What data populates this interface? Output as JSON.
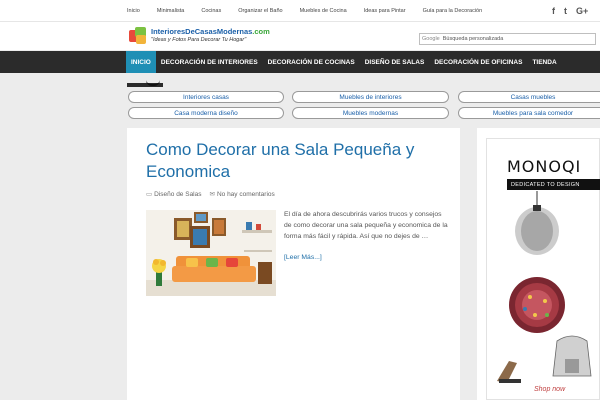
{
  "topbar": {
    "links": [
      "Inicio",
      "Minimalista",
      "Cocinas",
      "Organizar el Baño",
      "Muebles de Cocina",
      "Ideas para Pintar",
      "Guía para la Decoración"
    ],
    "social_icons": [
      "facebook-icon",
      "twitter-icon",
      "google-plus-icon"
    ],
    "social_glyphs": [
      "f",
      "𝕥",
      "G+"
    ]
  },
  "header": {
    "site_name": "InterioresDeCasasModernas",
    "site_tld": ".com",
    "tagline": "\"Ideas y Fotos Para Decorar Tu Hogar\"",
    "search_placeholder": "Búsqueda personalizada",
    "search_prefix": "Google"
  },
  "mainnav": {
    "items": [
      "INICIO",
      "DECORACIÓN DE INTERIORES",
      "DECORACIÓN DE COCINAS",
      "DISEÑO DE SALAS",
      "DECORACIÓN DE OFICINAS",
      "TIENDA"
    ],
    "active_color": "#1f8fb5"
  },
  "pills": [
    "Interiores casas",
    "Muebles de interiores",
    "Casas muebles",
    "Casa moderna diseño",
    "Muebles modernas",
    "Muebles para sala comedor"
  ],
  "article": {
    "title": "Como Decorar una Sala Pequeña y Economica",
    "category": "Diseño de Salas",
    "comments": "No hay comentarios",
    "excerpt": "El día de ahora descubrirás varios trucos y consejos de como decorar una sala pequeña y economica de la forma más fácil y rápida. Así que no dejes de …",
    "read_more": "[Leer Más...]"
  },
  "ad": {
    "brand": "MONOQI",
    "subtitle": "DEDICATED TO DESIGN",
    "cta": "Shop now"
  }
}
